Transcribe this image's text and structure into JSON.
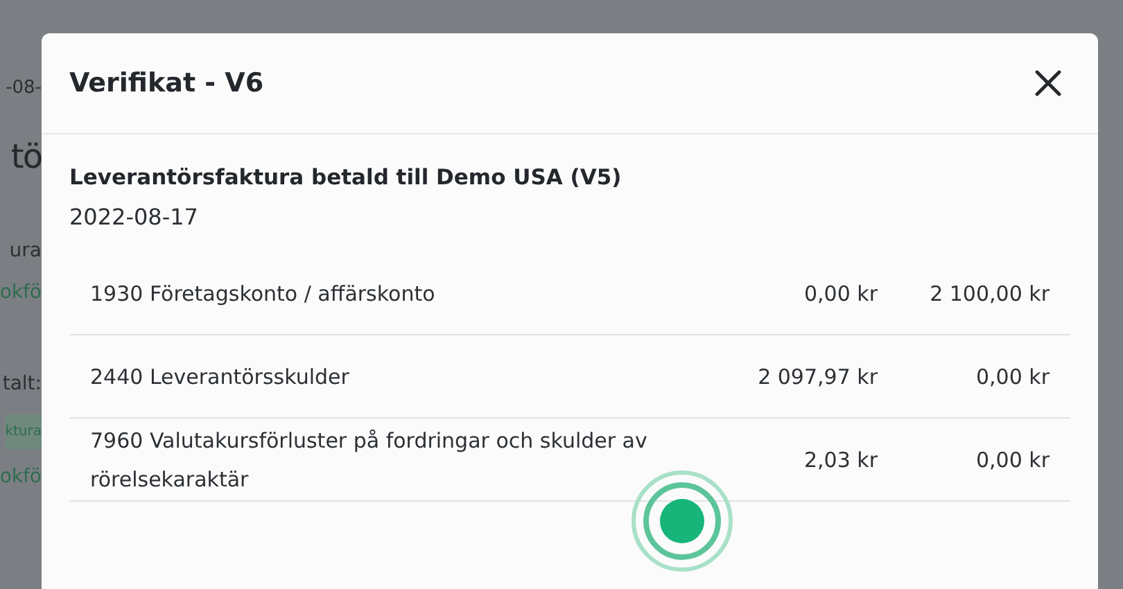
{
  "background": {
    "items": [
      {
        "kind": "date",
        "text": "-08-"
      },
      {
        "kind": "heading",
        "text": "tö"
      },
      {
        "kind": "text",
        "text": "ura"
      },
      {
        "kind": "link",
        "text": "okfö"
      },
      {
        "kind": "text",
        "text": "talt:"
      },
      {
        "kind": "badge",
        "text": "ktura"
      },
      {
        "kind": "link",
        "text": "okfö"
      }
    ]
  },
  "modal": {
    "title": "Verifikat - V6",
    "description": "Leverantörsfaktura betald till Demo USA (V5)",
    "date": "2022-08-17",
    "rows": [
      {
        "account": "1930 Företagskonto / affärskonto",
        "debit": "0,00 kr",
        "credit": "2 100,00 kr"
      },
      {
        "account": "2440 Leverantörsskulder",
        "debit": "2 097,97 kr",
        "credit": "0,00 kr"
      },
      {
        "account": "7960 Valutakursförluster på fordringar och skulder av rörelsekaraktär",
        "debit": "2,03 kr",
        "credit": "0,00 kr"
      }
    ]
  }
}
